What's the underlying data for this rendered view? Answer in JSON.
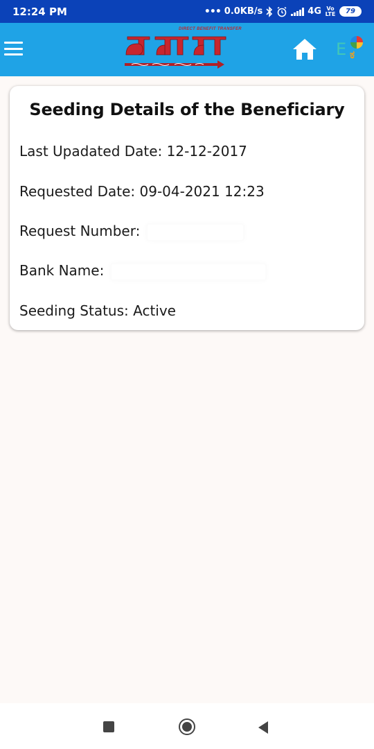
{
  "status_bar": {
    "time": "12:24 PM",
    "network_speed": "0.0KB/s",
    "network_type": "4G",
    "volte_label": "Vo LTE",
    "battery_level": "79"
  },
  "app_bar": {
    "logo_caption": "DIRECT BENEFIT TRANSFER",
    "icons": {
      "menu": "hamburger-menu-icon",
      "home": "home-icon",
      "language": "language-toggle-icon"
    },
    "lang_e": "E",
    "lang_k": "ಕ",
    "colors": {
      "background": "#1fa3e6",
      "status_bar": "#0b42b8"
    }
  },
  "card": {
    "title": "Seeding Details of the Beneficiary",
    "last_updated": "Last Upadated Date: 12-12-2017",
    "requested_date": "Requested Date: 09-04-2021 12:23",
    "request_number_label": "Request Number:",
    "bank_name_label": "Bank Name:",
    "seeding_status": "Seeding Status: Active"
  },
  "nav_bar": {
    "icons": {
      "recents": "square-recents-icon",
      "home": "circle-home-icon",
      "back": "triangle-back-icon"
    }
  }
}
